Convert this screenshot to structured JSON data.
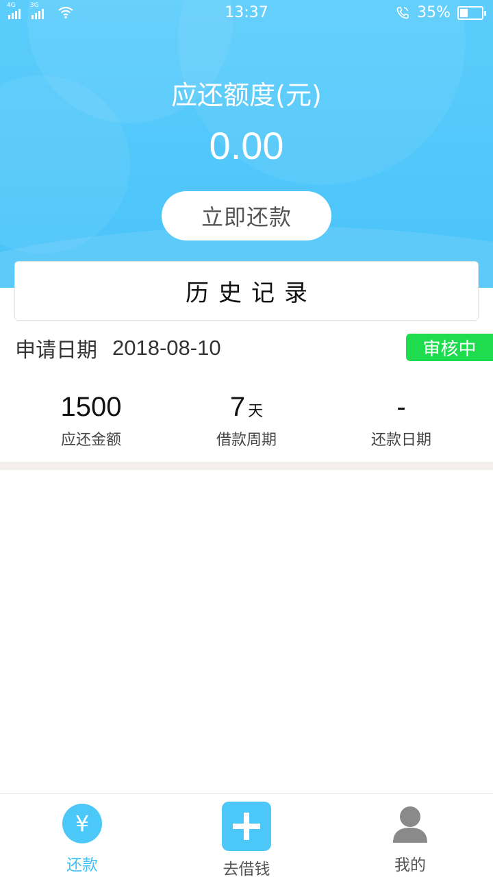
{
  "status_bar": {
    "network1": "4G",
    "network2": "3G",
    "time": "13:37",
    "battery": "35%",
    "battery_level": 0.35
  },
  "hero": {
    "title": "应还额度(元)",
    "amount": "0.00",
    "repay_button": "立即还款"
  },
  "history": {
    "title": "历史记录"
  },
  "record": {
    "apply_label": "申请日期",
    "apply_date": "2018-08-10",
    "status": "审核中",
    "amount_value": "1500",
    "amount_label": "应还金额",
    "period_value": "7",
    "period_unit": "天",
    "period_label": "借款周期",
    "repay_date_value": "-",
    "repay_date_label": "还款日期"
  },
  "tabs": [
    {
      "label": "还款",
      "icon": "yen-icon",
      "active": true
    },
    {
      "label": "去借钱",
      "icon": "plus-icon",
      "active": false
    },
    {
      "label": "我的",
      "icon": "person-icon",
      "active": false
    }
  ],
  "colors": {
    "primary": "#4cc8f8",
    "status_green": "#1fdc4f",
    "divider": "#f4efec"
  }
}
